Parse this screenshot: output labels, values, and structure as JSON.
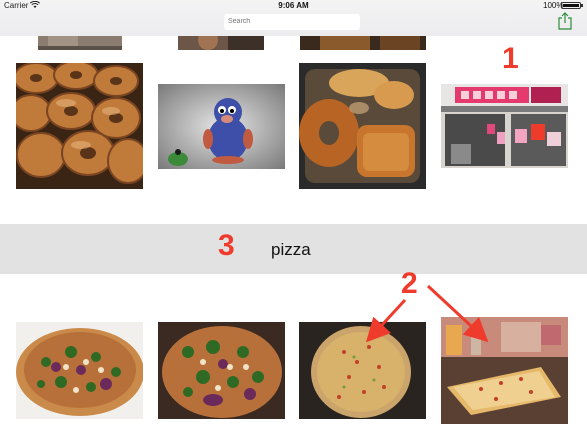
{
  "status_bar": {
    "carrier": "Carrier",
    "time": "9:06 AM",
    "battery": "100%",
    "battery_level": 1.0
  },
  "search": {
    "placeholder": "Search"
  },
  "section": {
    "title": "pizza"
  },
  "annotations": {
    "one": "1",
    "two": "2",
    "three": "3"
  },
  "colors": {
    "annotation": "#ef3b2c",
    "section_header_bg": "#e2e2e3",
    "tint": "#2d8c3c"
  }
}
